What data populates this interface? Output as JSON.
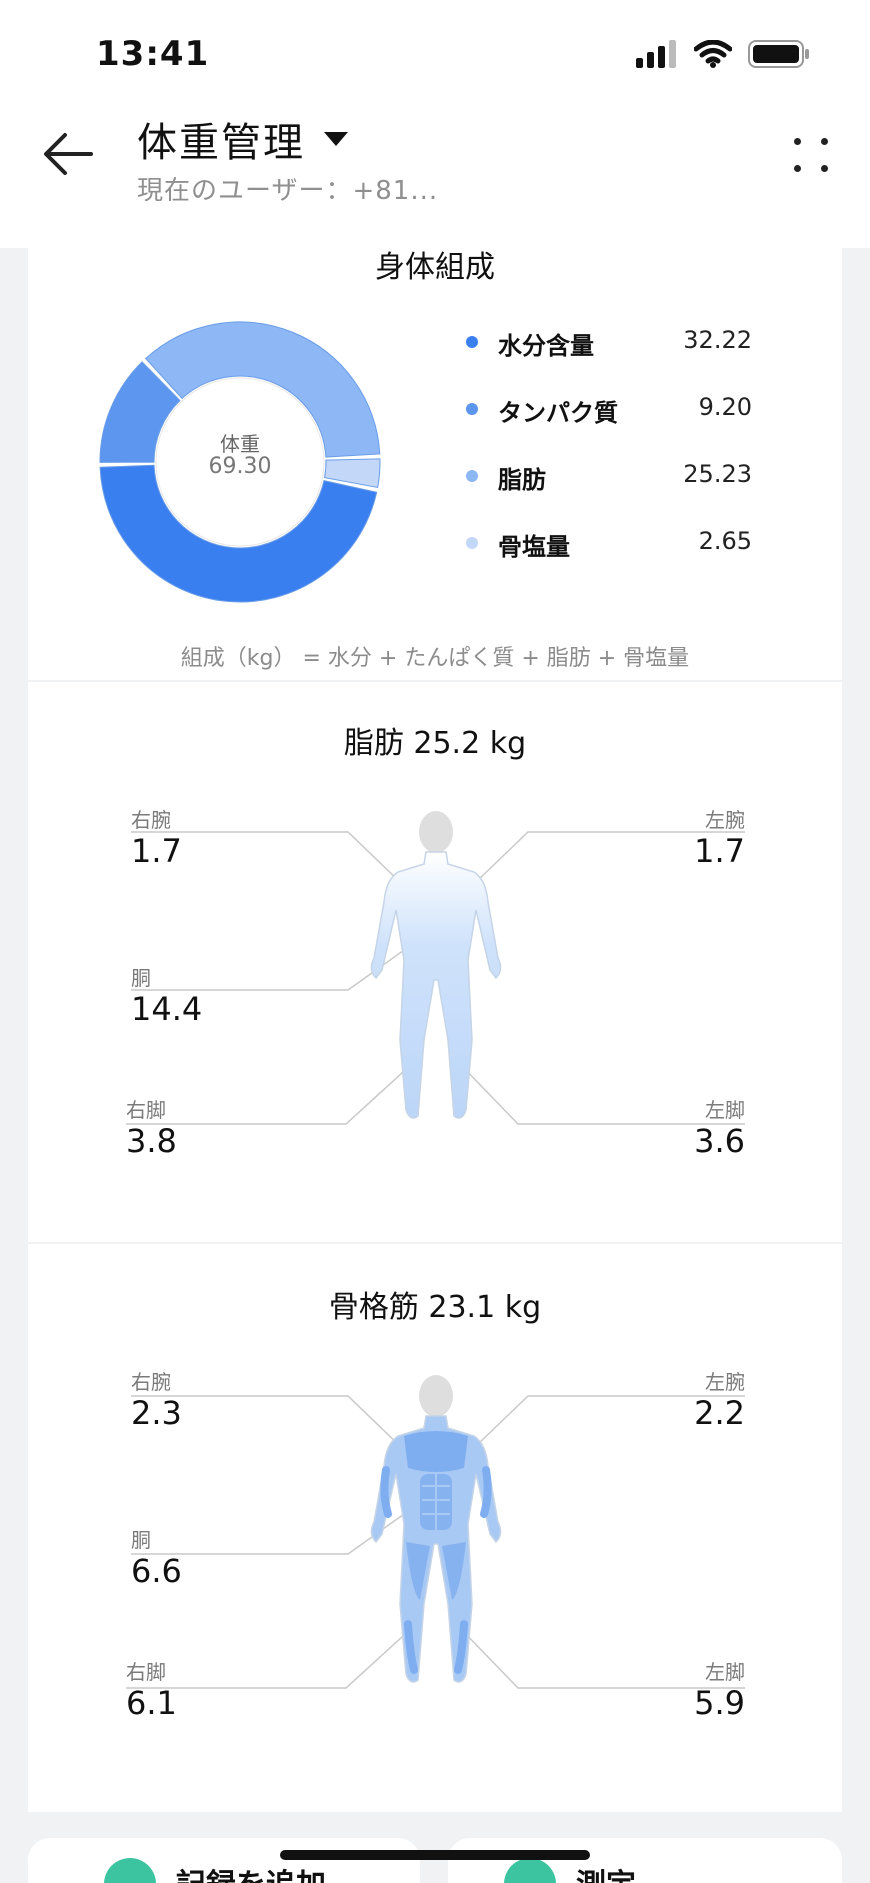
{
  "status_bar": {
    "time": "13:41"
  },
  "header": {
    "title": "体重管理",
    "subtitle": "現在のユーザー：+81..."
  },
  "composition": {
    "title": "身体組成",
    "center_label": "体重",
    "center_value": "69.30",
    "formula": "組成（kg） = 水分 + たんぱく質 + 脂肪 + 骨塩量",
    "items": [
      {
        "name": "水分含量",
        "value": "32.22",
        "color": "#3a7ff0"
      },
      {
        "name": "タンパク質",
        "value": "9.20",
        "color": "#5c96ee"
      },
      {
        "name": "脂肪",
        "value": "25.23",
        "color": "#8db7f5"
      },
      {
        "name": "骨塩量",
        "value": "2.65",
        "color": "#c3d8f8"
      }
    ]
  },
  "fat": {
    "title": "脂肪 25.2 kg",
    "right_arm": {
      "label": "右腕",
      "value": "1.7"
    },
    "left_arm": {
      "label": "左腕",
      "value": "1.7"
    },
    "trunk": {
      "label": "胴",
      "value": "14.4"
    },
    "right_leg": {
      "label": "右脚",
      "value": "3.8"
    },
    "left_leg": {
      "label": "左脚",
      "value": "3.6"
    }
  },
  "muscle": {
    "title": "骨格筋 23.1 kg",
    "right_arm": {
      "label": "右腕",
      "value": "2.3"
    },
    "left_arm": {
      "label": "左腕",
      "value": "2.2"
    },
    "trunk": {
      "label": "胴",
      "value": "6.6"
    },
    "right_leg": {
      "label": "右脚",
      "value": "6.1"
    },
    "left_leg": {
      "label": "左脚",
      "value": "5.9"
    }
  },
  "bottom": {
    "add_record": "記録を追加",
    "measure": "測定"
  }
}
